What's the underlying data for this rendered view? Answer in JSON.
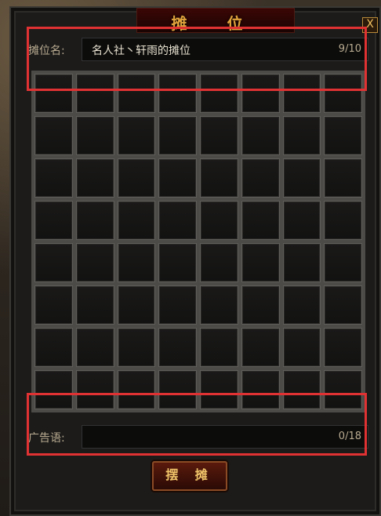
{
  "window": {
    "title": "摊 位",
    "close_label": "X"
  },
  "stall": {
    "label": "摊位名:",
    "value": "名人社丶轩雨的摊位",
    "count": "9/10"
  },
  "ad": {
    "label": "广告语:",
    "value": "",
    "count": "0/18"
  },
  "buttons": {
    "set_stall": "摆 摊"
  },
  "grid": {
    "rows": 8,
    "cols": 8
  },
  "colors": {
    "highlight": "#e03232",
    "accent": "#e0a33c"
  }
}
